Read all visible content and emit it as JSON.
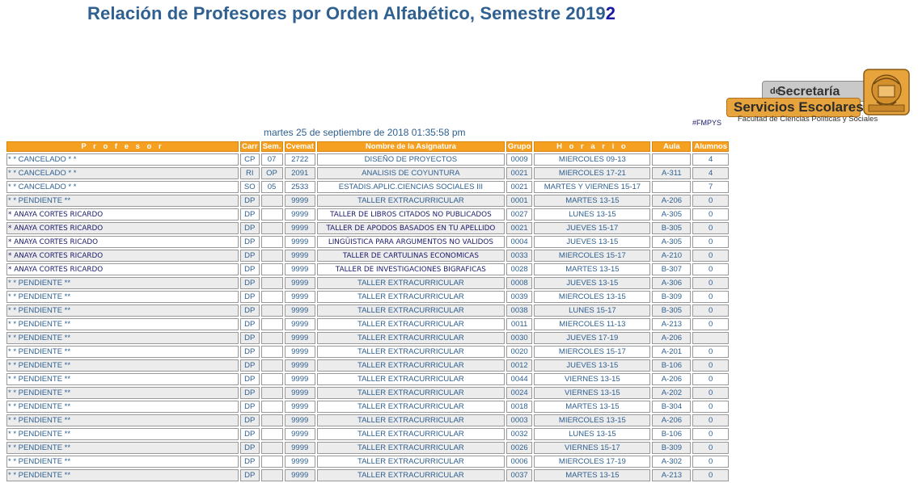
{
  "title": {
    "main": "Relación de Profesores por Orden Alfabético, Semestre 2019",
    "last_digit": "2"
  },
  "logo": {
    "line1": "Secretaría",
    "line1_small": "de",
    "line2": "Servicios Escolares",
    "subtitle": "Facultad de Ciencias Políticas y Sociales"
  },
  "hashtag": "#FMPYS",
  "datetime": "martes 25 de septiembre de 2018 01:35:58 pm",
  "colors": {
    "header_bg": "#f5a020",
    "text": "#2f6090",
    "title": "#2f6090",
    "row_alt": "#ececec"
  },
  "table": {
    "headers": [
      "P r o f e s o r",
      "Carr",
      "Sem.",
      "Cvemat",
      "Nombre de la Asignatura",
      "Grupo",
      "H o r a r i o",
      "Aula",
      "Alumnos"
    ],
    "rows": [
      [
        "* * CANCELADO * *",
        "CP",
        "07",
        "2722",
        "DISEÑO DE PROYECTOS",
        "0009",
        "MIERCOLES 09-13",
        "",
        "4"
      ],
      [
        "* * CANCELADO * *",
        "RI",
        "OP",
        "2091",
        "ANALISIS DE COYUNTURA",
        "0021",
        "MIERCOLES 17-21",
        "A-311",
        "4"
      ],
      [
        "* * CANCELADO * *",
        "SO",
        "05",
        "2533",
        "ESTADIS.APLIC.CIENCIAS SOCIALES III",
        "0021",
        "MARTES Y VIERNES 15-17",
        "",
        "7"
      ],
      [
        "* * PENDIENTE **",
        "DP",
        "",
        "9999",
        "TALLER EXTRACURRICULAR",
        "0001",
        "MARTES 13-15",
        "A-206",
        "0"
      ],
      [
        "* ANAYA CORTES RICARDO",
        "DP",
        "",
        "9999",
        "TALLER DE LIBROS CITADOS NO PUBLICADOS",
        "0027",
        "LUNES 13-15",
        "A-305",
        "0"
      ],
      [
        "* ANAYA CORTES RICARDO",
        "DP",
        "",
        "9999",
        "TALLER DE APODOS BASADOS EN TU APELLIDO",
        "0021",
        "JUEVES 15-17",
        "B-305",
        "0"
      ],
      [
        "* ANAYA CORTES RICADO",
        "DP",
        "",
        "9999",
        "LINGÜISTICA PARA ARGUMENTOS NO VALIDOS",
        "0004",
        "JUEVES 13-15",
        "A-305",
        "0"
      ],
      [
        "* ANAYA CORTES RICARDO",
        "DP",
        "",
        "9999",
        "TALLER DE CARTULINAS ECONOMICAS",
        "0033",
        "MIERCOLES 15-17",
        "A-210",
        "0"
      ],
      [
        "* ANAYA CORTES RICARDO",
        "DP",
        "",
        "9999",
        "TALLER DE INVESTIGACIONES BIGRAFICAS",
        "0028",
        "MARTES 13-15",
        "B-307",
        "0"
      ],
      [
        "* * PENDIENTE **",
        "DP",
        "",
        "9999",
        "TALLER EXTRACURRICULAR",
        "0008",
        "JUEVES 13-15",
        "A-306",
        "0"
      ],
      [
        "* * PENDIENTE **",
        "DP",
        "",
        "9999",
        "TALLER EXTRACURRICULAR",
        "0039",
        "MIERCOLES 13-15",
        "B-309",
        "0"
      ],
      [
        "* * PENDIENTE **",
        "DP",
        "",
        "9999",
        "TALLER EXTRACURRICULAR",
        "0038",
        "LUNES 15-17",
        "B-305",
        "0"
      ],
      [
        "* * PENDIENTE **",
        "DP",
        "",
        "9999",
        "TALLER EXTRACURRICULAR",
        "0011",
        "MIERCOLES 11-13",
        "A-213",
        "0"
      ],
      [
        "* * PENDIENTE **",
        "DP",
        "",
        "9999",
        "TALLER EXTRACURRICULAR",
        "0030",
        "JUEVES 17-19",
        "A-206",
        ""
      ],
      [
        "* * PENDIENTE **",
        "DP",
        "",
        "9999",
        "TALLER EXTRACURRICULAR",
        "0020",
        "MIERCOLES 15-17",
        "A-201",
        "0"
      ],
      [
        "* * PENDIENTE **",
        "DP",
        "",
        "9999",
        "TALLER EXTRACURRICULAR",
        "0012",
        "JUEVES 13-15",
        "B-106",
        "0"
      ],
      [
        "* * PENDIENTE **",
        "DP",
        "",
        "9999",
        "TALLER EXTRACURRICULAR",
        "0044",
        "VIERNES 13-15",
        "A-206",
        "0"
      ],
      [
        "* * PENDIENTE **",
        "DP",
        "",
        "9999",
        "TALLER EXTRACURRICULAR",
        "0024",
        "VIERNES 13-15",
        "A-202",
        "0"
      ],
      [
        "* * PENDIENTE **",
        "DP",
        "",
        "9999",
        "TALLER EXTRACURRICULAR",
        "0018",
        "MARTES 13-15",
        "B-304",
        "0"
      ],
      [
        "* * PENDIENTE **",
        "DP",
        "",
        "9999",
        "TALLER EXTRACURRICULAR",
        "0003",
        "MIERCOLES 13-15",
        "A-206",
        "0"
      ],
      [
        "* * PENDIENTE **",
        "DP",
        "",
        "9999",
        "TALLER EXTRACURRICULAR",
        "0032",
        "LUNES 13-15",
        "B-106",
        "0"
      ],
      [
        "* * PENDIENTE **",
        "DP",
        "",
        "9999",
        "TALLER EXTRACURRICULAR",
        "0026",
        "VIERNES 15-17",
        "B-309",
        "0"
      ],
      [
        "* * PENDIENTE **",
        "DP",
        "",
        "9999",
        "TALLER EXTRACURRICULAR",
        "0006",
        "MIERCOLES 17-19",
        "A-302",
        "0"
      ],
      [
        "* * PENDIENTE **",
        "DP",
        "",
        "9999",
        "TALLER EXTRACURRICULAR",
        "0037",
        "MARTES 13-15",
        "A-213",
        "0"
      ]
    ]
  }
}
